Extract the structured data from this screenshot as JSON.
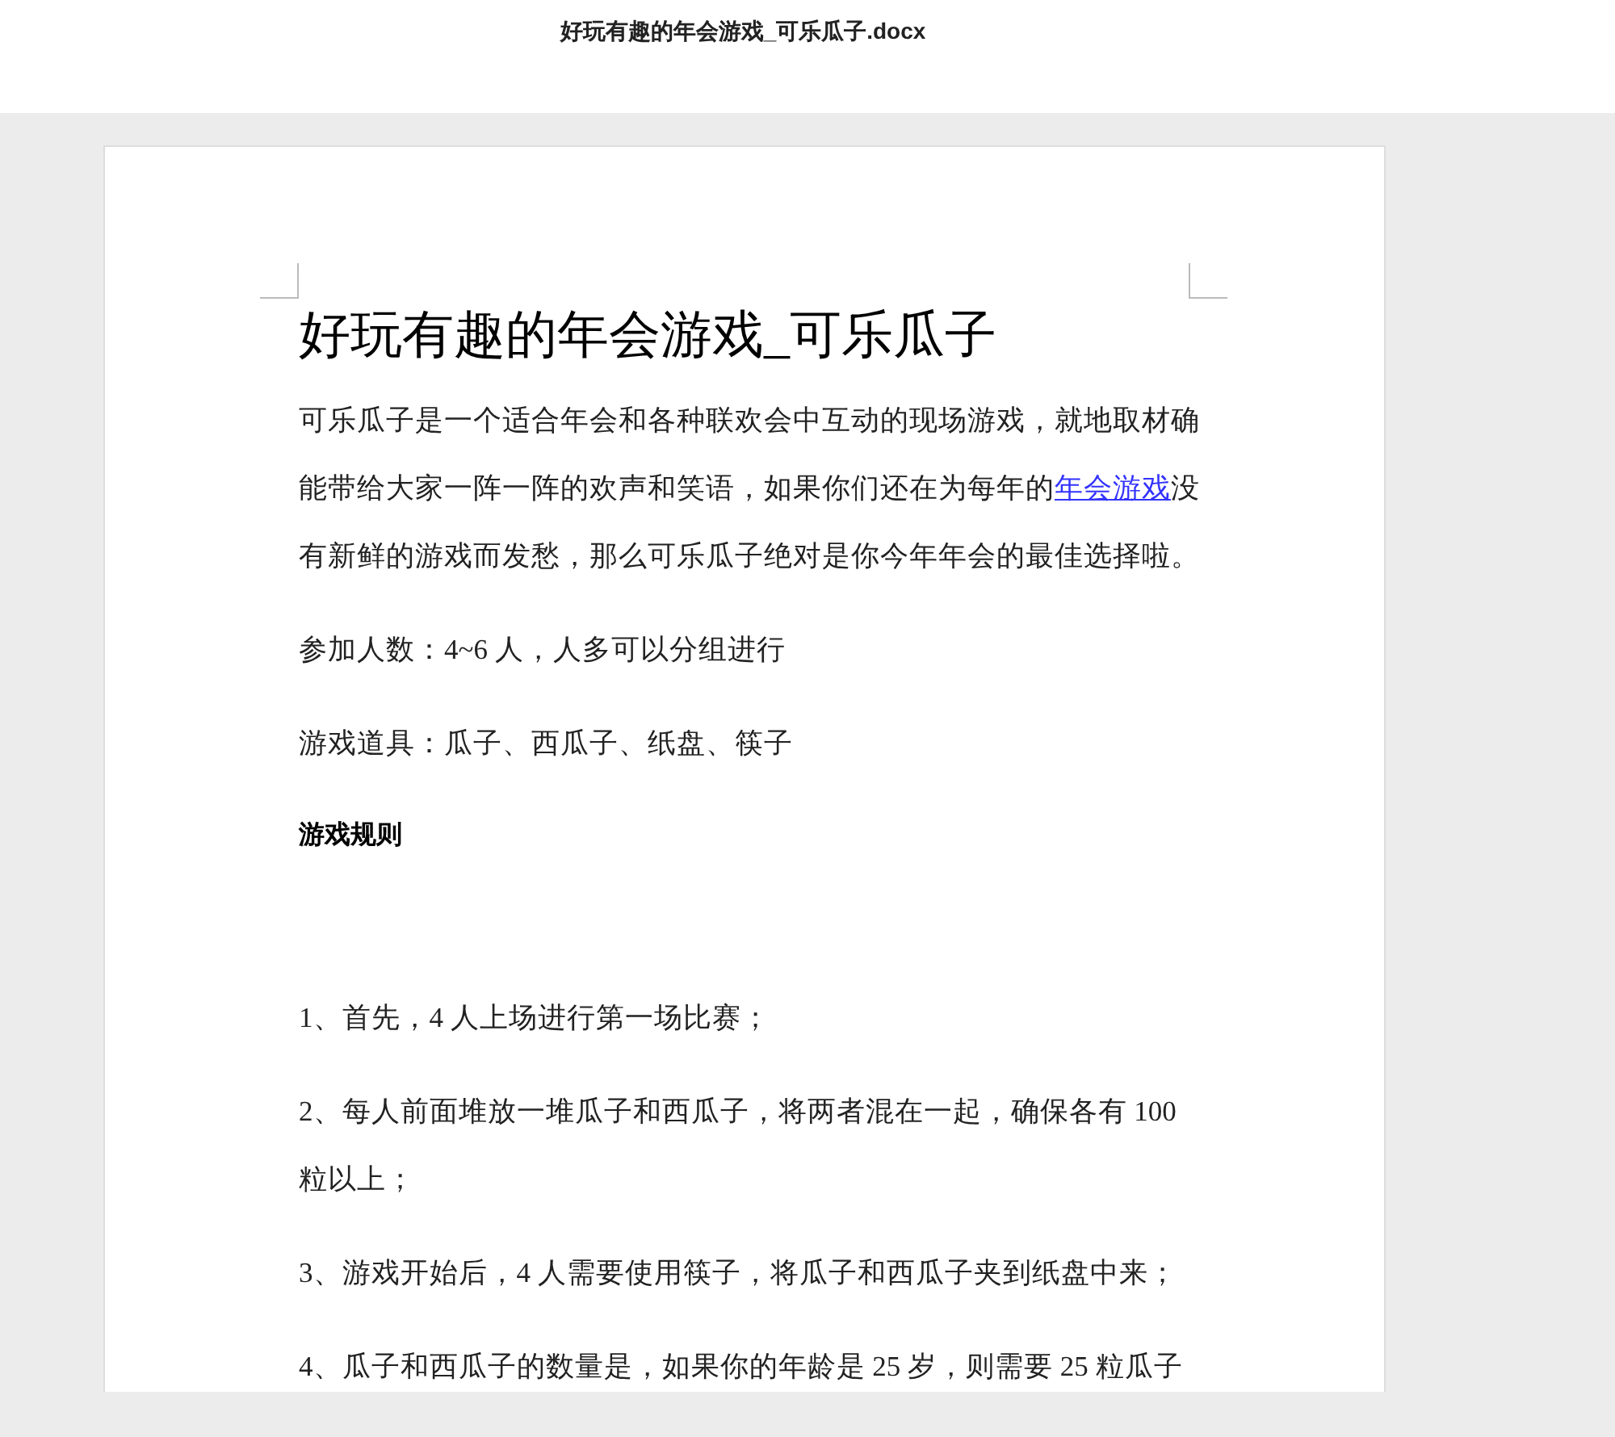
{
  "window": {
    "title": "好玩有趣的年会游戏_可乐瓜子.docx"
  },
  "document": {
    "heading": "好玩有趣的年会游戏_可乐瓜子",
    "paragraphs": [
      {
        "kind": "linked",
        "before": "可乐瓜子是一个适合年会和各种联欢会中互动的现场游戏，就地取材确能带给大家一阵一阵的欢声和笑语，如果你们还在为每年的",
        "link": "年会游戏",
        "after": "没有新鲜的游戏而发愁，那么可乐瓜子绝对是你今年年会的最佳选择啦。"
      },
      {
        "kind": "text",
        "text": "参加人数：4~6 人，人多可以分组进行"
      },
      {
        "kind": "text",
        "text": "游戏道具：瓜子、西瓜子、纸盘、筷子"
      },
      {
        "kind": "bold",
        "text": "游戏规则"
      },
      {
        "kind": "text",
        "text": "1、首先，4 人上场进行第一场比赛；"
      },
      {
        "kind": "text",
        "text": "2、每人前面堆放一堆瓜子和西瓜子，将两者混在一起，确保各有 100 粒以上；"
      },
      {
        "kind": "text",
        "text": "3、游戏开始后，4 人需要使用筷子，将瓜子和西瓜子夹到纸盘中来；"
      },
      {
        "kind": "text",
        "text": "4、瓜子和西瓜子的数量是，如果你的年龄是 25 岁，则需要 25 粒瓜子"
      }
    ]
  }
}
